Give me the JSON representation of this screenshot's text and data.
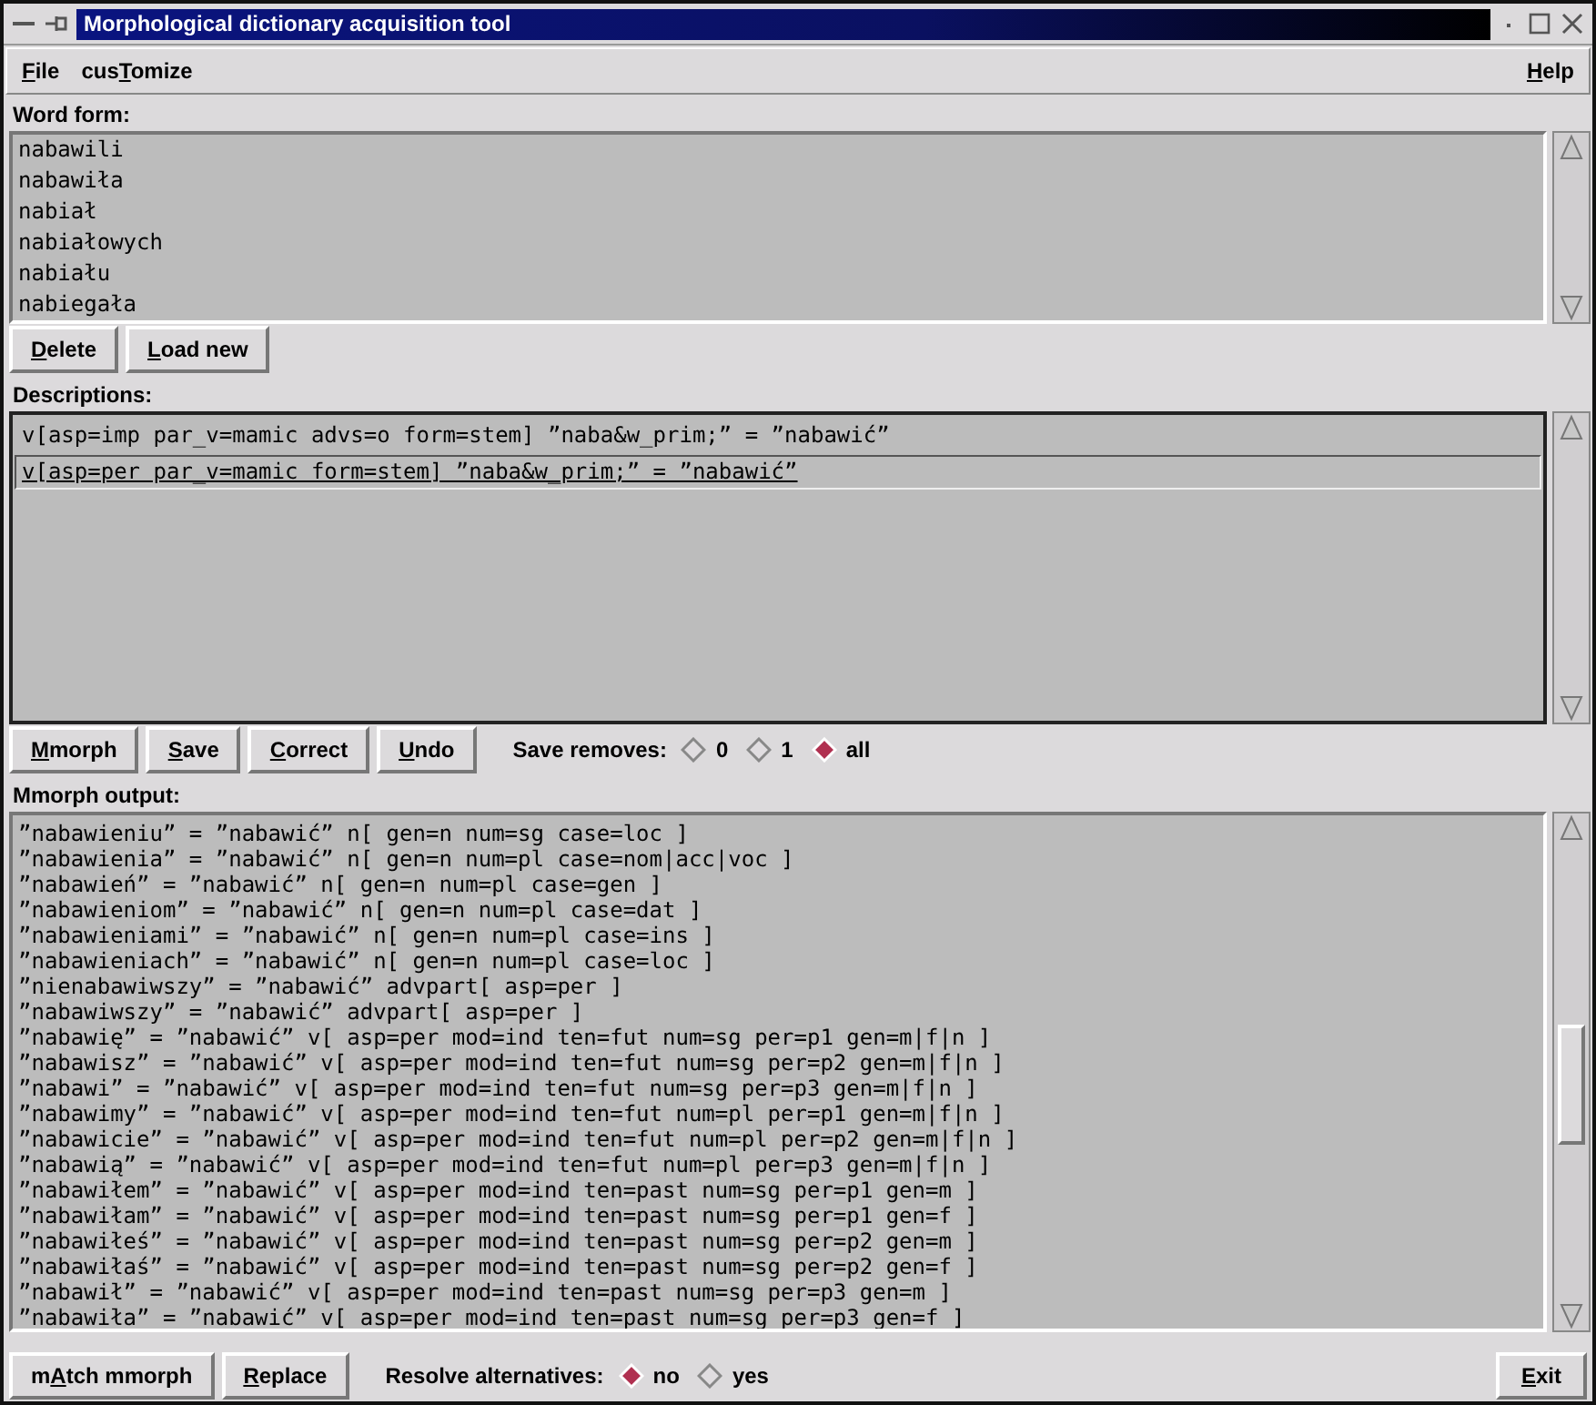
{
  "window": {
    "title": "Morphological dictionary acquisition tool"
  },
  "menu": [
    {
      "key": "F",
      "post": "ile"
    },
    {
      "pre": "cus",
      "key": "T",
      "post": "omize"
    }
  ],
  "help_menu": {
    "key": "H",
    "post": "elp"
  },
  "word_form": {
    "label": "Word form:",
    "items": [
      "nabawili",
      "nabawiła",
      "nabiał",
      "nabiałowych",
      "nabiału",
      "nabiegała"
    ],
    "buttons": [
      {
        "key": "D",
        "post": "elete"
      },
      {
        "key": "L",
        "post": "oad new"
      }
    ]
  },
  "descriptions": {
    "label": "Descriptions:",
    "items": [
      {
        "text": "v[asp=imp par_v=mamic advs=o form=stem] ”naba&w_prim;” = ”nabawić”",
        "selected": false
      },
      {
        "text": "v[asp=per par_v=mamic form=stem] ”naba&w_prim;” = ”nabawić”",
        "selected": true
      }
    ],
    "buttons": [
      {
        "key": "M",
        "post": "morph"
      },
      {
        "key": "S",
        "post": "ave"
      },
      {
        "key": "C",
        "post": "orrect"
      },
      {
        "key": "U",
        "post": "ndo"
      }
    ],
    "radio_group": {
      "label": "Save removes:",
      "options": [
        {
          "label": "0",
          "selected": false
        },
        {
          "label": "1",
          "selected": false
        },
        {
          "label": "all",
          "selected": true
        }
      ]
    }
  },
  "mmorph_output": {
    "label": "Mmorph output:",
    "lines": [
      "”nabawieniu” = ”nabawić” n[ gen=n num=sg case=loc ]",
      "”nabawienia” = ”nabawić” n[ gen=n num=pl case=nom|acc|voc ]",
      "”nabawień” = ”nabawić” n[ gen=n num=pl case=gen ]",
      "”nabawieniom” = ”nabawić” n[ gen=n num=pl case=dat ]",
      "”nabawieniami” = ”nabawić” n[ gen=n num=pl case=ins ]",
      "”nabawieniach” = ”nabawić” n[ gen=n num=pl case=loc ]",
      "”nienabawiwszy” = ”nabawić” advpart[ asp=per ]",
      "”nabawiwszy” = ”nabawić” advpart[ asp=per ]",
      "”nabawię” = ”nabawić” v[ asp=per mod=ind ten=fut num=sg per=p1 gen=m|f|n ]",
      "”nabawisz” = ”nabawić” v[ asp=per mod=ind ten=fut num=sg per=p2 gen=m|f|n ]",
      "”nabawi” = ”nabawić” v[ asp=per mod=ind ten=fut num=sg per=p3 gen=m|f|n ]",
      "”nabawimy” = ”nabawić” v[ asp=per mod=ind ten=fut num=pl per=p1 gen=m|f|n ]",
      "”nabawicie” = ”nabawić” v[ asp=per mod=ind ten=fut num=pl per=p2 gen=m|f|n ]",
      "”nabawią” = ”nabawić” v[ asp=per mod=ind ten=fut num=pl per=p3 gen=m|f|n ]",
      "”nabawiłem” = ”nabawić” v[ asp=per mod=ind ten=past num=sg per=p1 gen=m ]",
      "”nabawiłam” = ”nabawić” v[ asp=per mod=ind ten=past num=sg per=p1 gen=f ]",
      "”nabawiłeś” = ”nabawić” v[ asp=per mod=ind ten=past num=sg per=p2 gen=m ]",
      "”nabawiłaś” = ”nabawić” v[ asp=per mod=ind ten=past num=sg per=p2 gen=f ]",
      "”nabawił” = ”nabawić” v[ asp=per mod=ind ten=past num=sg per=p3 gen=m ]",
      "”nabawiła” = ”nabawić” v[ asp=per mod=ind ten=past num=sg per=p3 gen=f ]"
    ],
    "buttons": [
      {
        "pre": "m",
        "key": "A",
        "post": "tch mmorph"
      },
      {
        "key": "R",
        "post": "eplace"
      }
    ],
    "radio_group": {
      "label": "Resolve alternatives:",
      "options": [
        {
          "label": "no",
          "selected": true
        },
        {
          "label": "yes",
          "selected": false
        }
      ]
    },
    "exit_button": {
      "key": "E",
      "post": "xit"
    }
  }
}
